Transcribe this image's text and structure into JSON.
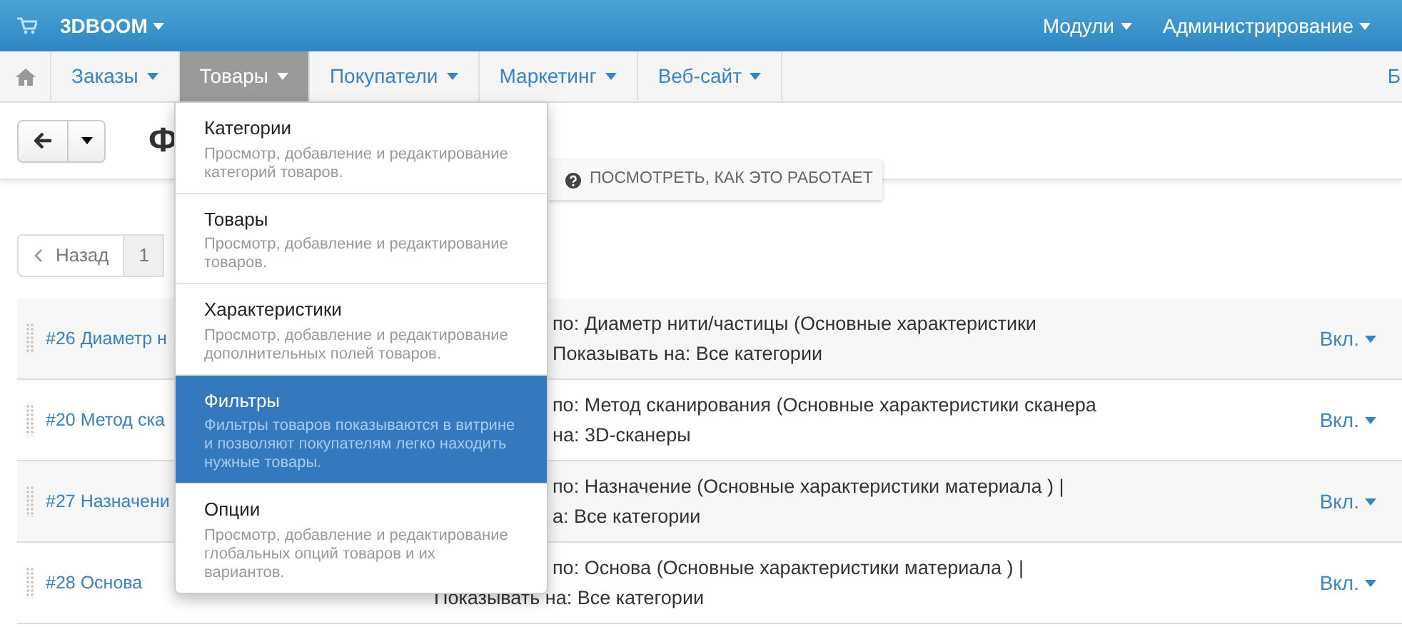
{
  "top_bar": {
    "brand": "3DBOOM",
    "right_menus": [
      "Модули",
      "Администрирование"
    ]
  },
  "nav": {
    "items": [
      {
        "label": "Заказы",
        "selected": false
      },
      {
        "label": "Товары",
        "selected": true
      },
      {
        "label": "Покупатели",
        "selected": false
      },
      {
        "label": "Маркетинг",
        "selected": false
      },
      {
        "label": "Веб-сайт",
        "selected": false
      }
    ],
    "edge_text": "Б"
  },
  "dropdown": [
    {
      "title": "Категории",
      "description": "Просмотр, добавление и редактирование категорий товаров.",
      "selected": false
    },
    {
      "title": "Товары",
      "description": "Просмотр, добавление и редактирование товаров.",
      "selected": false
    },
    {
      "title": "Характеристики",
      "description": "Просмотр, добавление и редактирование дополнительных полей товаров.",
      "selected": false
    },
    {
      "title": "Фильтры",
      "description": "Фильтры товаров показываются в витрине и позволяют покупателям легко находить нужные товары.",
      "selected": true
    },
    {
      "title": "Опции",
      "description": "Просмотр, добавление и редактирование глобальных опций товаров и их вариантов.",
      "selected": false
    }
  ],
  "page_title": "Ф",
  "help_link": "ПОСМОТРЕТЬ, КАК ЭТО РАБОТАЕТ",
  "pagination": {
    "prev": "Назад",
    "pages": [
      "1"
    ]
  },
  "rows": [
    {
      "name": "#26 Диаметр н",
      "lines": [
        {
          "text": "по: Диаметр нити/частицы (Основные характеристики",
          "covered": true
        },
        {
          "text": "Показывать на: Все категории",
          "covered": true
        }
      ],
      "status": "Вкл."
    },
    {
      "name": "#20 Метод ска",
      "lines": [
        {
          "text": "по: Метод сканирования (Основные характеристики сканера",
          "covered": true
        },
        {
          "text": "на: 3D-сканеры",
          "covered": true
        }
      ],
      "status": "Вкл."
    },
    {
      "name": "#27 Назначени",
      "lines": [
        {
          "text": "по: Назначение (Основные характеристики материала ) |",
          "covered": true
        },
        {
          "text": "а: Все категории",
          "covered": true
        }
      ],
      "status": "Вкл."
    },
    {
      "name": "#28 Основа",
      "lines": [
        {
          "text": "по: Основа (Основные характеристики материала ) |",
          "covered": true
        },
        {
          "text": "Показывать на: Все категории"
        }
      ],
      "status": "Вкл."
    }
  ]
}
